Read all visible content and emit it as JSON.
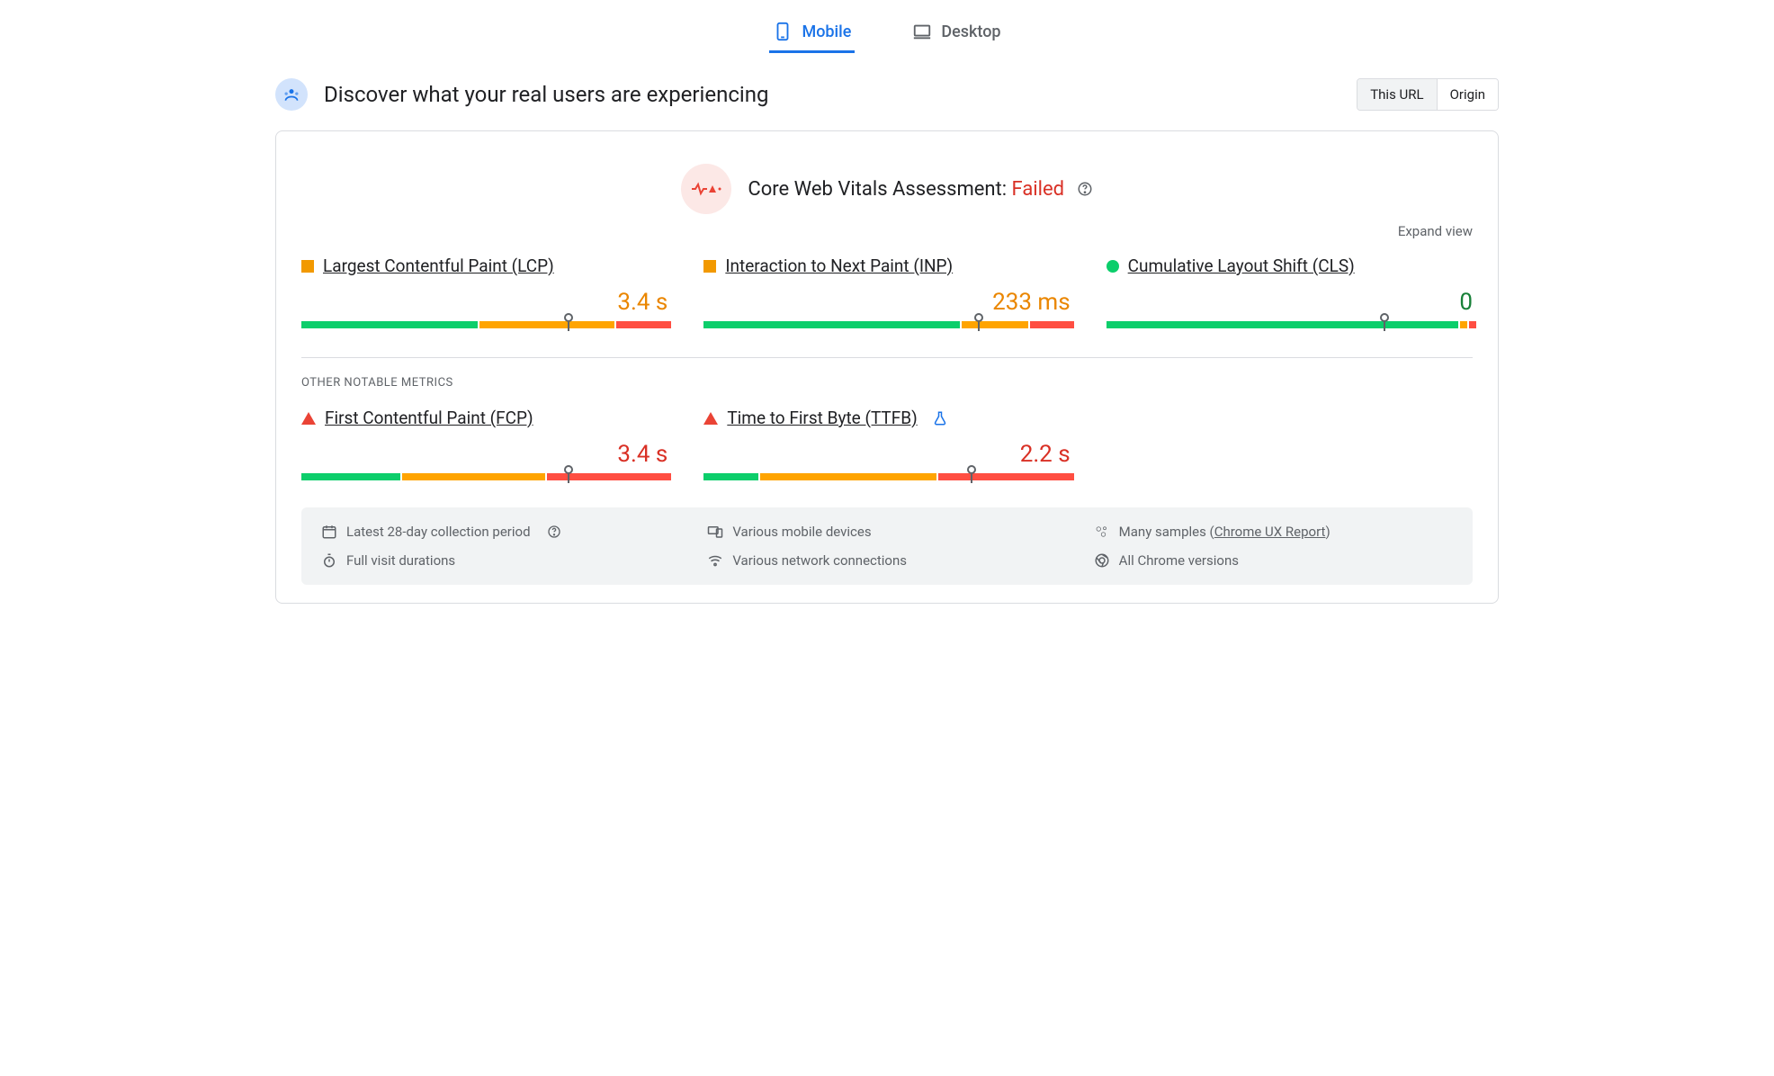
{
  "tabs": {
    "mobile": "Mobile",
    "desktop": "Desktop",
    "active": "mobile"
  },
  "header": {
    "title": "Discover what your real users are experiencing"
  },
  "scope": {
    "this_url": "This URL",
    "origin": "Origin",
    "active": "this_url"
  },
  "assessment": {
    "label": "Core Web Vitals Assessment:",
    "status": "Failed"
  },
  "expand_label": "Expand view",
  "section_other": "OTHER NOTABLE METRICS",
  "metrics": {
    "lcp": {
      "name": "Largest Contentful Paint (LCP)",
      "value": "3.4 s",
      "status": "orange",
      "bar": {
        "g": 48,
        "o": 37,
        "r": 15
      },
      "marker_pct": 73
    },
    "inp": {
      "name": "Interaction to Next Paint (INP)",
      "value": "233 ms",
      "status": "orange",
      "bar": {
        "g": 70,
        "o": 18,
        "r": 12
      },
      "marker_pct": 75
    },
    "cls": {
      "name": "Cumulative Layout Shift (CLS)",
      "value": "0",
      "status": "green",
      "bar": {
        "g": 96,
        "o": 2,
        "r": 2
      },
      "marker_pct": 76
    },
    "fcp": {
      "name": "First Contentful Paint (FCP)",
      "value": "3.4 s",
      "status": "red",
      "bar": {
        "g": 27,
        "o": 39,
        "r": 34
      },
      "marker_pct": 73
    },
    "ttfb": {
      "name": "Time to First Byte (TTFB)",
      "value": "2.2 s",
      "status": "red",
      "bar": {
        "g": 15,
        "o": 48,
        "r": 37
      },
      "marker_pct": 73
    }
  },
  "info": {
    "period": "Latest 28-day collection period",
    "devices": "Various mobile devices",
    "samples_pre": "Many samples (",
    "samples_link": "Chrome UX Report",
    "samples_post": ")",
    "durations": "Full visit durations",
    "network": "Various network connections",
    "chrome": "All Chrome versions"
  }
}
